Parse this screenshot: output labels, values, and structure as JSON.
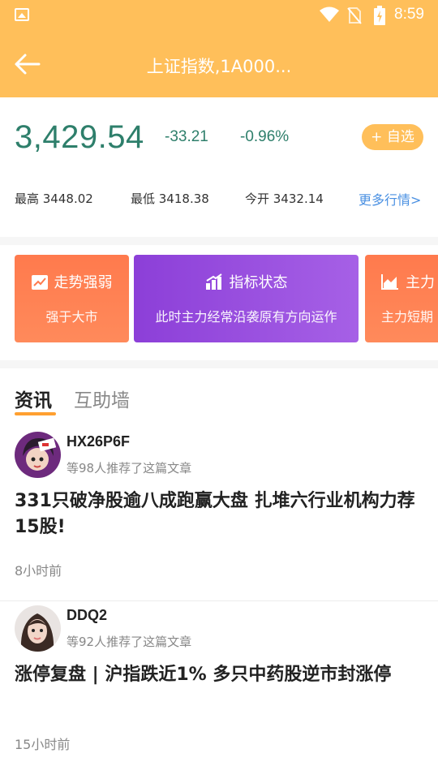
{
  "status_bar": {
    "time": "8:59"
  },
  "header": {
    "title": "上证指数,1A000..."
  },
  "quote": {
    "price": "3,429.54",
    "change": "-33.21",
    "change_pct": "-0.96%",
    "add_label": "+ 自选",
    "high": "最高 3448.02",
    "low": "最低 3418.38",
    "open": "今开 3432.14",
    "more": "更多行情>"
  },
  "cards": [
    {
      "title": "走势强弱",
      "sub": "强于大市",
      "icon": "trend-chart-icon"
    },
    {
      "title": "指标状态",
      "sub": "此时主力经常沿袭原有方向运作",
      "icon": "bar-chart-icon"
    },
    {
      "title": "主力",
      "sub": "主力短期",
      "icon": "area-chart-icon"
    }
  ],
  "tabs": {
    "news": "资讯",
    "wall": "互助墙"
  },
  "articles": [
    {
      "author": "HX26P6F",
      "recommend": "等98人推荐了这篇文章",
      "headline": "331只破净股逾八成跑赢大盘 扎堆六行业机构力荐15股!",
      "time": "8小时前"
    },
    {
      "author": "DDQ2",
      "recommend": "等92人推荐了这篇文章",
      "headline": "涨停复盘 | 沪指跌近1% 多只中药股逆市封涨停",
      "time": "15小时前"
    }
  ],
  "colors": {
    "accent": "#ffbf5a",
    "down": "#2e7f6b",
    "link": "#4a90e2",
    "purple": "#9a4fe0",
    "orange": "#ff7f50"
  }
}
